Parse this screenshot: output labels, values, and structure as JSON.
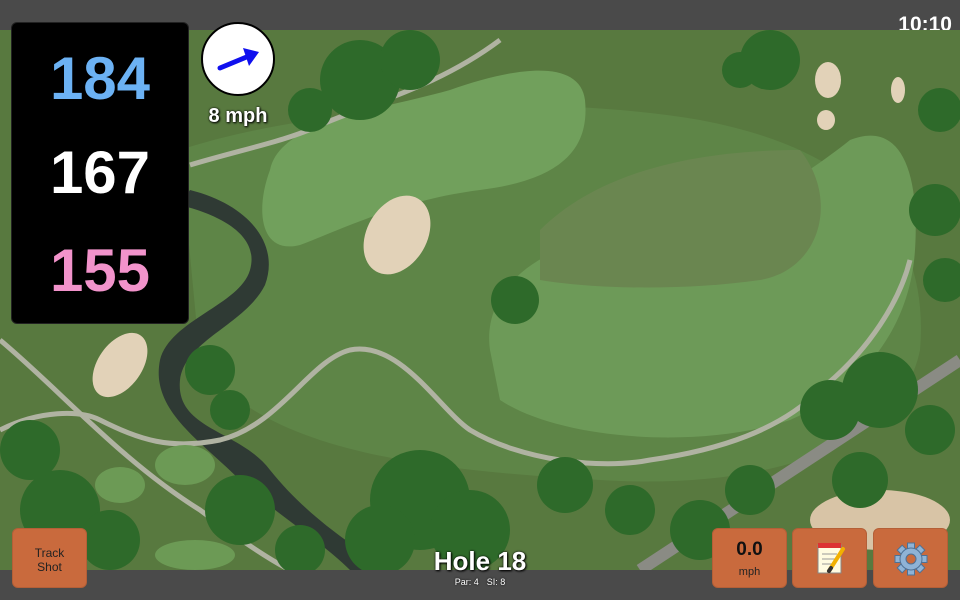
{
  "status_bar": {
    "time": "10:10"
  },
  "distances": {
    "back": "184",
    "middle": "167",
    "front": "155"
  },
  "wind": {
    "speed_label": "8 mph",
    "direction_icon": "wind-arrow-icon"
  },
  "buttons": {
    "track_shot_line1": "Track",
    "track_shot_line2": "Shot",
    "wind_value": "0.0",
    "wind_unit": "mph",
    "notes_icon": "notepad-icon",
    "settings_icon": "gear-icon"
  },
  "hole": {
    "title": "Hole 18",
    "par_label": "Par: 4",
    "si_label": "SI: 8"
  },
  "colors": {
    "back_distance": "#6cb2f4",
    "middle_distance": "#ffffff",
    "front_distance": "#f293cb",
    "button_bg": "#c96a3d"
  }
}
